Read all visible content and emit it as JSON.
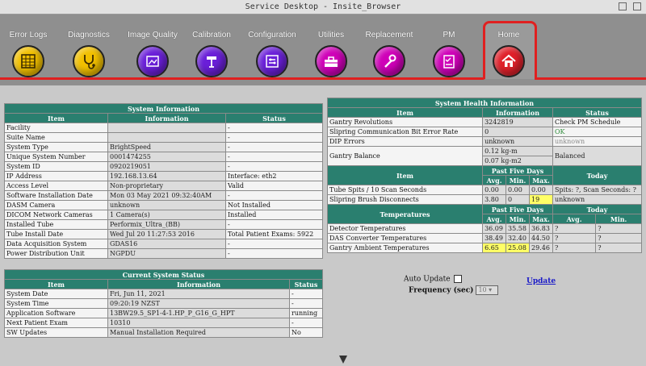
{
  "window": {
    "title": "Service Desktop - Insite_Browser"
  },
  "toolbar": {
    "items": [
      {
        "label": "Error Logs",
        "icon": "error-log-icon",
        "color": "#f2c000"
      },
      {
        "label": "Diagnostics",
        "icon": "stethoscope-icon",
        "color": "#f2c000"
      },
      {
        "label": "Image Quality",
        "icon": "image-quality-icon",
        "color": "#6a1fd8"
      },
      {
        "label": "Calibration",
        "icon": "calibration-icon",
        "color": "#6a1fd8"
      },
      {
        "label": "Configuration",
        "icon": "configuration-icon",
        "color": "#6a1fd8"
      },
      {
        "label": "Utilities",
        "icon": "toolbox-icon",
        "color": "#cf00b8"
      },
      {
        "label": "Replacement",
        "icon": "wrench-icon",
        "color": "#cf00b8"
      },
      {
        "label": "PM",
        "icon": "checklist-icon",
        "color": "#cf00b8"
      },
      {
        "label": "Home",
        "icon": "home-icon",
        "color": "#e0202a"
      }
    ]
  },
  "system_info": {
    "title": "System Information",
    "headers": [
      "Item",
      "Information",
      "Status"
    ],
    "rows": [
      {
        "item": "Facility",
        "info": "",
        "status": "-"
      },
      {
        "item": "Suite Name",
        "info": "",
        "status": "-"
      },
      {
        "item": "System Type",
        "info": "BrightSpeed",
        "status": "-"
      },
      {
        "item": "Unique System Number",
        "info": "0001474255",
        "status": "-"
      },
      {
        "item": "System ID",
        "info": "0920219051",
        "status": "-"
      },
      {
        "item": "IP Address",
        "info": "192.168.13.64",
        "status": "Interface: eth2"
      },
      {
        "item": "Access Level",
        "info": "Non-proprietary",
        "status": "Valid"
      },
      {
        "item": "Software Installation Date",
        "info": "Mon 03 May 2021 09:32:40AM",
        "status": "-"
      },
      {
        "item": "DASM Camera",
        "info": "unknown",
        "status": "Not Installed"
      },
      {
        "item": "DICOM Network Cameras",
        "info": "1 Camera(s)",
        "status": "Installed"
      },
      {
        "item": "Installed Tube",
        "info": "Performix_Ultra_(BB)",
        "status": "-"
      },
      {
        "item": "Tube Install Date",
        "info": "Wed Jul 20 11:27:53 2016",
        "status": "Total Patient Exams: 5922"
      },
      {
        "item": "Data Acquisition System",
        "info": "GDAS16",
        "status": "-"
      },
      {
        "item": "Power Distribution Unit",
        "info": "NGPDU",
        "status": "-"
      }
    ]
  },
  "current_status": {
    "title": "Current System Status",
    "headers": [
      "Item",
      "Information",
      "Status"
    ],
    "rows": [
      {
        "item": "System Date",
        "info": "Fri, Jun 11, 2021",
        "status": "-"
      },
      {
        "item": "System Time",
        "info": "09:20:19 NZST",
        "status": "-"
      },
      {
        "item": "Application Software",
        "info": "13BW29.5_SP1-4-1.HP_P_G16_G_HPT",
        "status": "running"
      },
      {
        "item": "Next Patient Exam",
        "info": "10310",
        "status": "-"
      },
      {
        "item": "SW Updates",
        "info": "Manual Installation Required",
        "status": "No"
      }
    ]
  },
  "health": {
    "title": "System Health Information",
    "headers": [
      "Item",
      "Information",
      "Status"
    ],
    "rows": [
      {
        "item": "Gantry Revolutions",
        "info": "3242819",
        "status": "Check PM Schedule"
      },
      {
        "item": "Slipring Communication Bit Error Rate",
        "info": "0",
        "status": "OK"
      },
      {
        "item": "DIP Errors",
        "info": "unknown",
        "status": "unknown"
      }
    ],
    "balance": {
      "item": "Gantry Balance",
      "info1": "0.12 kg-m",
      "info2": "0.07 kg-m2",
      "status": "Balanced"
    },
    "five_days_label": "Past Five Days",
    "today_label": "Today",
    "avg_label": "Avg.",
    "min_label": "Min.",
    "max_label": "Max.",
    "item_label": "Item",
    "spits": [
      {
        "item": "Tube Spits / 10 Scan Seconds",
        "avg": "0.00",
        "min": "0.00",
        "max": "0.00",
        "today": "Spits: ?, Scan Seconds: ?"
      },
      {
        "item": "Slipring Brush Disconnects",
        "avg": "3.80",
        "min": "0",
        "max": "19",
        "today": "unknown"
      }
    ],
    "temps_label": "Temperatures",
    "temps": [
      {
        "item": "Detector Temperatures",
        "avg": "36.09",
        "min": "35.58",
        "max": "36.83",
        "t_avg": "?",
        "t_min": "?",
        "t_max": "?"
      },
      {
        "item": "DAS Converter Temperatures",
        "avg": "38.49",
        "min": "32.40",
        "max": "44.50",
        "t_avg": "?",
        "t_min": "?",
        "t_max": "?"
      },
      {
        "item": "Gantry Ambient Temperatures",
        "avg": "6.65",
        "min": "25.08",
        "max": "29.46",
        "t_avg": "?",
        "t_min": "?",
        "t_max": "?"
      }
    ]
  },
  "controls": {
    "auto_update_label": "Auto Update",
    "frequency_label": "Frequency (sec)",
    "frequency_value": "10",
    "update_link": "Update"
  }
}
